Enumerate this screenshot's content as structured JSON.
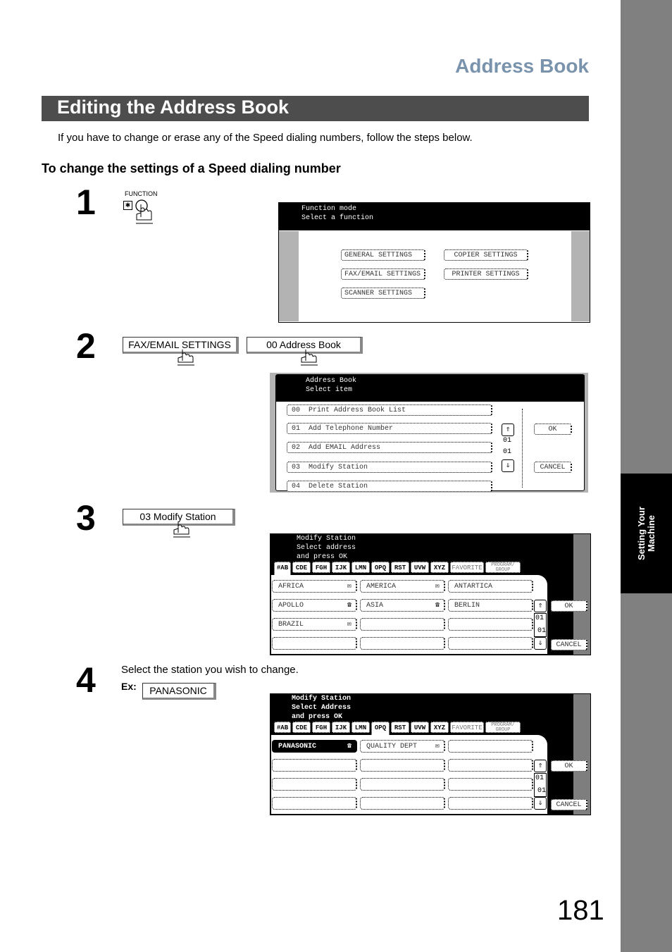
{
  "header": {
    "section_title": "Address Book"
  },
  "banner": {
    "title": "Editing the Address Book"
  },
  "intro": "If you have to change or erase any of the Speed dialing numbers, follow the steps below.",
  "subheading": "To change the settings of a Speed dialing number",
  "sidebar": {
    "tab_line1": "Setting Your",
    "tab_line2": "Machine"
  },
  "page_number": "181",
  "steps": [
    {
      "number": "1",
      "key_label": "FUNCTION",
      "key_symbol": "✱",
      "screen": {
        "header_lines": [
          "Function mode",
          "Select a function"
        ],
        "buttons": [
          "GENERAL SETTINGS",
          "COPIER SETTINGS",
          "FAX/EMAIL SETTINGS",
          "PRINTER SETTINGS",
          "SCANNER SETTINGS"
        ]
      }
    },
    {
      "number": "2",
      "press_buttons": [
        "FAX/EMAIL SETTINGS",
        "00 Address Book"
      ],
      "screen": {
        "header_lines": [
          "Address Book",
          "Select item"
        ],
        "items": [
          {
            "num": "00",
            "label": "Print Address Book List"
          },
          {
            "num": "01",
            "label": "Add Telephone Number"
          },
          {
            "num": "02",
            "label": "Add EMAIL Address"
          },
          {
            "num": "03",
            "label": "Modify Station"
          },
          {
            "num": "04",
            "label": "Delete Station"
          }
        ],
        "page_current": "01",
        "page_total": "01",
        "ok": "OK",
        "cancel": "CANCEL"
      }
    },
    {
      "number": "3",
      "press_buttons": [
        "03 Modify Station"
      ],
      "screen": {
        "header_lines": [
          "Modify Station",
          "Select address",
          "and press OK"
        ],
        "tabs": [
          "#AB",
          "CDE",
          "FGH",
          "IJK",
          "LMN",
          "OPQ",
          "RST",
          "UVW",
          "XYZ",
          "FAVORITE",
          "PROGRAM/ GROUP"
        ],
        "active_tab": "#AB",
        "cells": [
          {
            "label": "AFRICA",
            "icon": "email"
          },
          {
            "label": "AMERICA",
            "icon": "email"
          },
          {
            "label": "ANTARTICA",
            "icon": ""
          },
          {
            "label": "APOLLO",
            "icon": "phone"
          },
          {
            "label": "ASIA",
            "icon": "phone"
          },
          {
            "label": "BERLIN",
            "icon": ""
          },
          {
            "label": "BRAZIL",
            "icon": "email"
          },
          {
            "label": "",
            "icon": ""
          },
          {
            "label": "",
            "icon": ""
          },
          {
            "label": "",
            "icon": ""
          },
          {
            "label": "",
            "icon": ""
          },
          {
            "label": "",
            "icon": ""
          }
        ],
        "page_current": "01",
        "page_total": "01",
        "ok": "OK",
        "cancel": "CANCEL"
      }
    },
    {
      "number": "4",
      "instruction": "Select the station you wish to change.",
      "example_label": "Ex:",
      "example_button": "PANASONIC",
      "screen": {
        "header_lines": [
          "Modify Station",
          "Select Address",
          "and press OK"
        ],
        "tabs": [
          "#AB",
          "CDE",
          "FGH",
          "IJK",
          "LMN",
          "OPQ",
          "RST",
          "UVW",
          "XYZ",
          "FAVORITE",
          "PROGRAM/ GROUP"
        ],
        "active_tab": "OPQ",
        "cells": [
          {
            "label": "PANASONIC",
            "icon": "phone",
            "selected": true
          },
          {
            "label": "QUALITY DEPT",
            "icon": "email"
          },
          {
            "label": "",
            "icon": ""
          },
          {
            "label": "",
            "icon": ""
          },
          {
            "label": "",
            "icon": ""
          },
          {
            "label": "",
            "icon": ""
          },
          {
            "label": "",
            "icon": ""
          },
          {
            "label": "",
            "icon": ""
          },
          {
            "label": "",
            "icon": ""
          },
          {
            "label": "",
            "icon": ""
          },
          {
            "label": "",
            "icon": ""
          },
          {
            "label": "",
            "icon": ""
          }
        ],
        "page_current": "01",
        "page_total": "01",
        "ok": "OK",
        "cancel": "CANCEL"
      }
    }
  ]
}
